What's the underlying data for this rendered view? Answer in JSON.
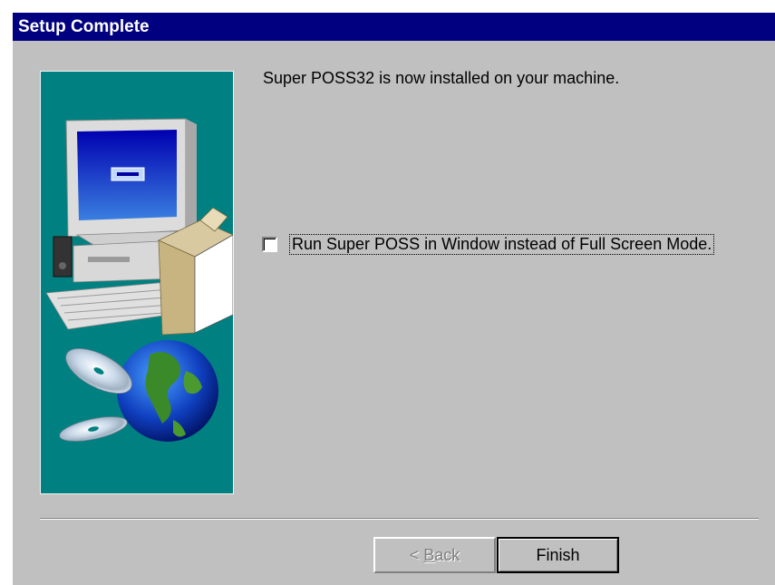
{
  "dialog": {
    "title": "Setup Complete",
    "message": "Super POSS32 is now installed on your machine.",
    "option_label": "Run Super POSS in Window instead of Full Screen Mode.",
    "option_checked": false
  },
  "buttons": {
    "back_prefix": "< ",
    "back_accel": "B",
    "back_rest": "ack",
    "finish": "Finish"
  },
  "colors": {
    "titlebar": "#000080",
    "dialog_bg": "#c0c0c0",
    "illustration_bg": "#008080"
  },
  "icons": [
    "computer-icon",
    "software-box-icon",
    "cd-disc-icon",
    "globe-icon"
  ]
}
